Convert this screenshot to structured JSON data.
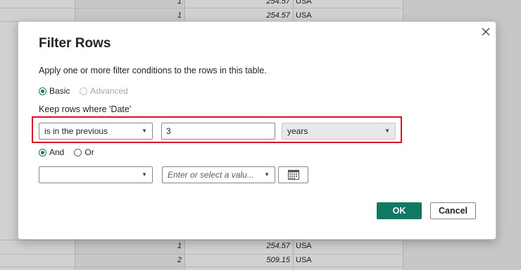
{
  "background_table": {
    "rows": [
      {
        "qty": "1",
        "amount": "254.57",
        "country": "USA"
      },
      {
        "qty": "1",
        "amount": "254.57",
        "country": "USA"
      },
      {
        "qty": "1",
        "amount": "254.57",
        "country": "USA"
      },
      {
        "qty": "2",
        "amount": "509.15",
        "country": "USA"
      }
    ]
  },
  "dialog": {
    "title": "Filter Rows",
    "close_icon": "close-icon",
    "description": "Apply one or more filter conditions to the rows in this table.",
    "mode_basic": "Basic",
    "mode_advanced": "Advanced",
    "keep_label": "Keep rows where 'Date'",
    "condition1": {
      "operator": "is in the previous",
      "value": "3",
      "unit": "years"
    },
    "logic_and": "And",
    "logic_or": "Or",
    "condition2": {
      "operator": "",
      "value_placeholder": "Enter or select a valu..."
    },
    "ok_label": "OK",
    "cancel_label": "Cancel"
  },
  "colors": {
    "accent": "#117865",
    "highlight": "#d8122a"
  }
}
